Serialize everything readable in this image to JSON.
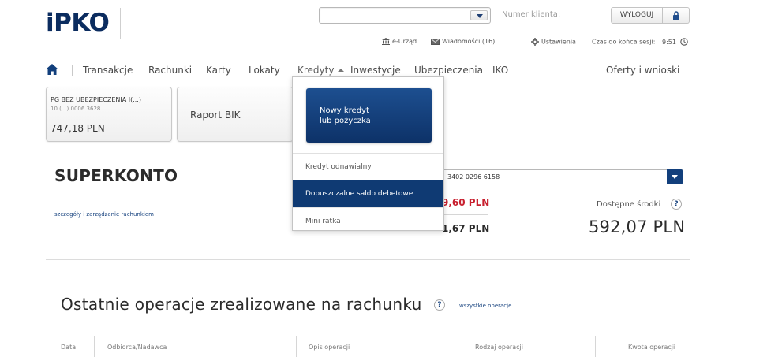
{
  "header": {
    "logo_text": "PKO",
    "logo_prefix": "i",
    "client_number_label": "Numer klienta:",
    "logout_label": "WYLOGUJ",
    "euriad_label": "e-Urząd",
    "messages_label": "Wiadomości (16)",
    "settings_label": "Ustawienia",
    "session_label": "Czas do końca sesji:",
    "session_time": "9:51"
  },
  "nav": {
    "items": [
      "Transakcje",
      "Rachunki",
      "Karty",
      "Lokaty",
      "Kredyty",
      "Inwestycje",
      "Ubezpieczenia",
      "IKO"
    ],
    "right_item": "Oferty i wnioski"
  },
  "tiles": [
    {
      "name": "PG BEZ UBEZPIECZENIA I(...)",
      "number": "10 (...) 0006 3628",
      "balance": "747,18 PLN"
    },
    {
      "label": "Raport BIK"
    }
  ],
  "dropdown": {
    "promo_label": "Nowy kredyt\nlub pożyczka",
    "items": [
      "Kredyt odnawialny",
      "Dopuszczalne saldo debetowe",
      "Mini ratka"
    ]
  },
  "account": {
    "title": "SUPERKONTO",
    "details_link": "szczegóły i zarządzanie rachunkiem",
    "number_partial": "3402 0296 6158",
    "balance_red": "9,60 PLN",
    "balance_black": "1,67 PLN",
    "available_label": "Dostępne środki",
    "available_amount": "592,07 PLN"
  },
  "operations": {
    "title": "Ostatnie operacje zrealizowane na rachunku",
    "all_link": "wszystkie operacje",
    "columns": [
      "Data",
      "Odbiorca/Nadawca",
      "Opis operacji",
      "Rodzaj operacji",
      "Kwota operacji"
    ]
  },
  "colors": {
    "brand_navy": "#0b2c5f",
    "accent_blue": "#123f7c",
    "negative_red": "#c8202f"
  }
}
